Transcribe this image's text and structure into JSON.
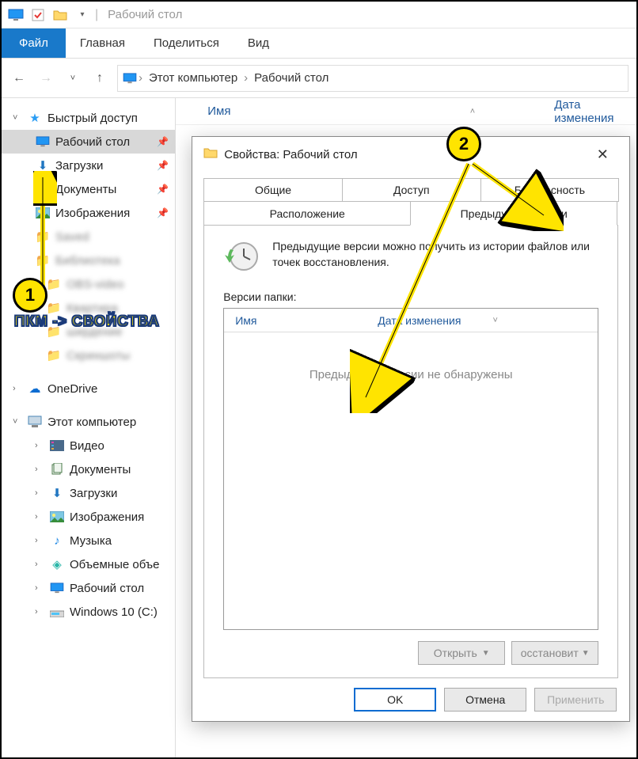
{
  "titlebar": {
    "title": "Рабочий стол"
  },
  "ribbon": {
    "file": "Файл",
    "home": "Главная",
    "share": "Поделиться",
    "view": "Вид"
  },
  "breadcrumb": {
    "root": "Этот компьютер",
    "leaf": "Рабочий стол"
  },
  "columns": {
    "name": "Имя",
    "date": "Дата изменения"
  },
  "sidebar": {
    "quick_access": "Быстрый доступ",
    "desktop": "Рабочий стол",
    "downloads": "Загрузки",
    "documents": "Документы",
    "pictures": "Изображения",
    "onedrive": "OneDrive",
    "this_pc": "Этот компьютер",
    "videos": "Видео",
    "documents2": "Документы",
    "downloads2": "Загрузки",
    "pictures2": "Изображения",
    "music": "Музыка",
    "objects3d": "Объемные объе",
    "desktop2": "Рабочий стол",
    "c_drive": "Windows 10 (C:)"
  },
  "dialog": {
    "title": "Свойства: Рабочий стол",
    "tabs": {
      "general": "Общие",
      "sharing": "Доступ",
      "security": "Безопасность",
      "location": "Расположение",
      "previous": "Предыдущие версии"
    },
    "description": "Предыдущие версии можно получить из истории файлов или точек восстановления.",
    "versions_label": "Версии папки:",
    "versions_cols": {
      "name": "Имя",
      "date": "Дата изменения"
    },
    "versions_empty": "Предыдущие версии не обнаружены",
    "btn_open": "Открыть",
    "btn_restore": "осстановит",
    "btn_ok": "OK",
    "btn_cancel": "Отмена",
    "btn_apply": "Применить"
  },
  "annotations": {
    "badge1": "1",
    "badge2": "2",
    "hint1": "ПКМ -> СВОЙСТВА"
  }
}
